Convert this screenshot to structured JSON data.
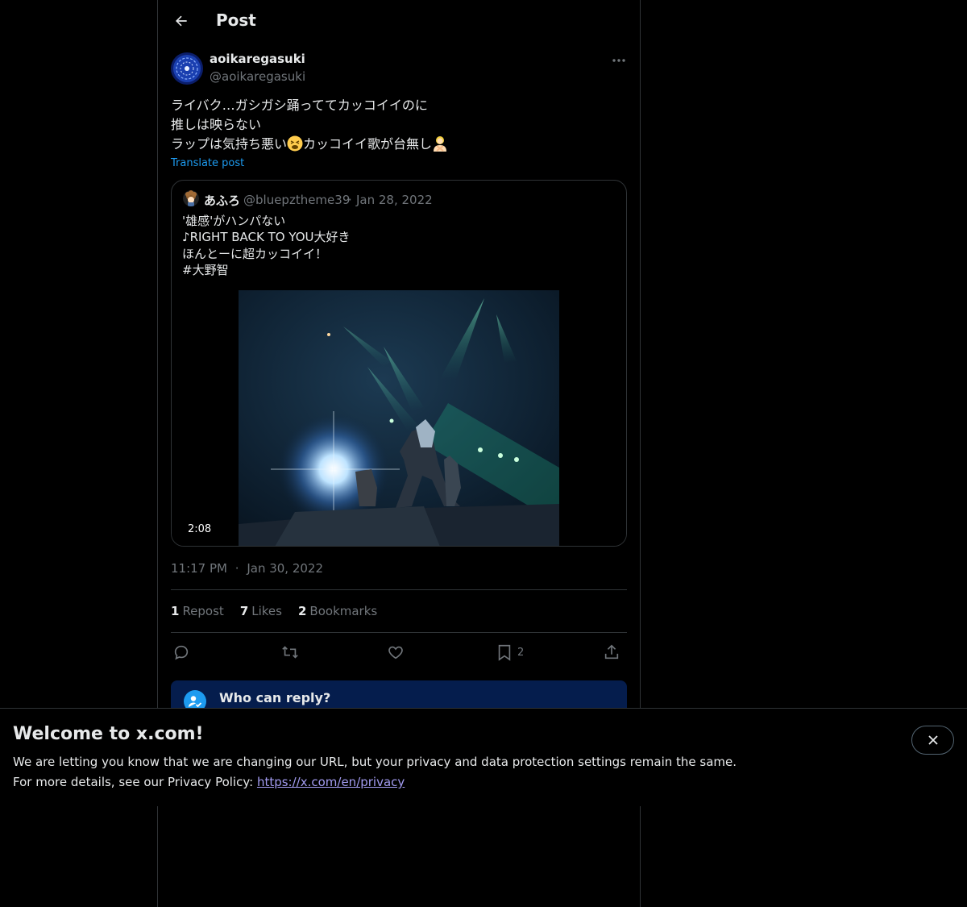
{
  "header": {
    "title": "Post"
  },
  "post": {
    "author_name": "aoikaregasuki",
    "author_handle": "@aoikaregasuki",
    "lines": [
      "ライバク…ガシガシ踊っててカッコイイのに",
      "推しは映らない",
      "ラップは気持ち悪い",
      "カッコイイ歌が台無し"
    ],
    "translate_label": "Translate post",
    "time": "11:17 PM",
    "date": "Jan 30, 2022",
    "separator": "·"
  },
  "quote": {
    "author_name": "あふろ",
    "author_handle": "@bluepztheme39",
    "separator": "·",
    "date": "Jan 28, 2022",
    "lines": [
      "'雄感'がハンパない",
      "♪RIGHT BACK TO YOU大好き",
      "ほんとーに超カッコイイ！",
      "#大野智"
    ],
    "video_duration": "2:08"
  },
  "stats": {
    "reposts_count": "1",
    "reposts_label": "Repost",
    "likes_count": "7",
    "likes_label": "Likes",
    "bookmarks_count": "2",
    "bookmarks_label": "Bookmarks"
  },
  "actions": {
    "bookmark_count": "2"
  },
  "who_can_reply": {
    "title": "Who can reply?"
  },
  "banner": {
    "title": "Welcome to x.com!",
    "line1": "We are letting you know that we are changing our URL, but your privacy and data protection settings remain the same.",
    "line2_prefix": "For more details, see our Privacy Policy: ",
    "link": "https://x.com/en/privacy"
  },
  "colors": {
    "accent": "#1d9bf0",
    "muted": "#71767b",
    "border": "#2f3336",
    "link": "#a29bf0",
    "reply_banner": "#051d4d"
  },
  "icons": [
    "back-arrow-icon",
    "more-icon",
    "reply-icon",
    "repost-icon",
    "like-icon",
    "bookmark-icon",
    "share-icon",
    "person-check-icon",
    "close-icon"
  ]
}
